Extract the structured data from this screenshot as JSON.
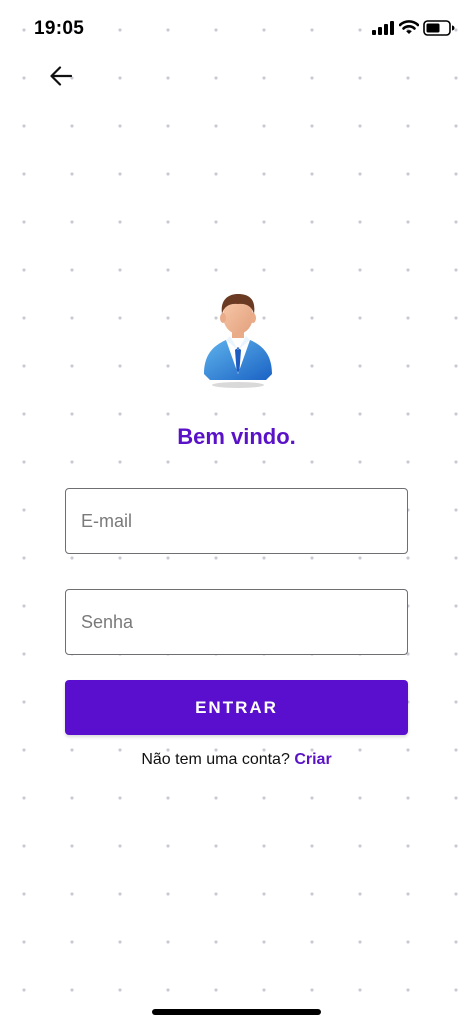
{
  "status_bar": {
    "time": "19:05",
    "icons": [
      "signal-icon",
      "wifi-icon",
      "battery-icon"
    ]
  },
  "header": {
    "back_icon": "arrow-left-icon"
  },
  "avatar": {
    "icon": "businessman-avatar"
  },
  "welcome_text": "Bem vindo.",
  "form": {
    "email_placeholder": "E-mail",
    "password_placeholder": "Senha",
    "submit_label": "ENTRAR"
  },
  "signup": {
    "prompt": "Não tem uma conta?",
    "link_label": "Criar"
  },
  "colors": {
    "accent": "#5a12c8",
    "button": "#5a0fcf"
  }
}
